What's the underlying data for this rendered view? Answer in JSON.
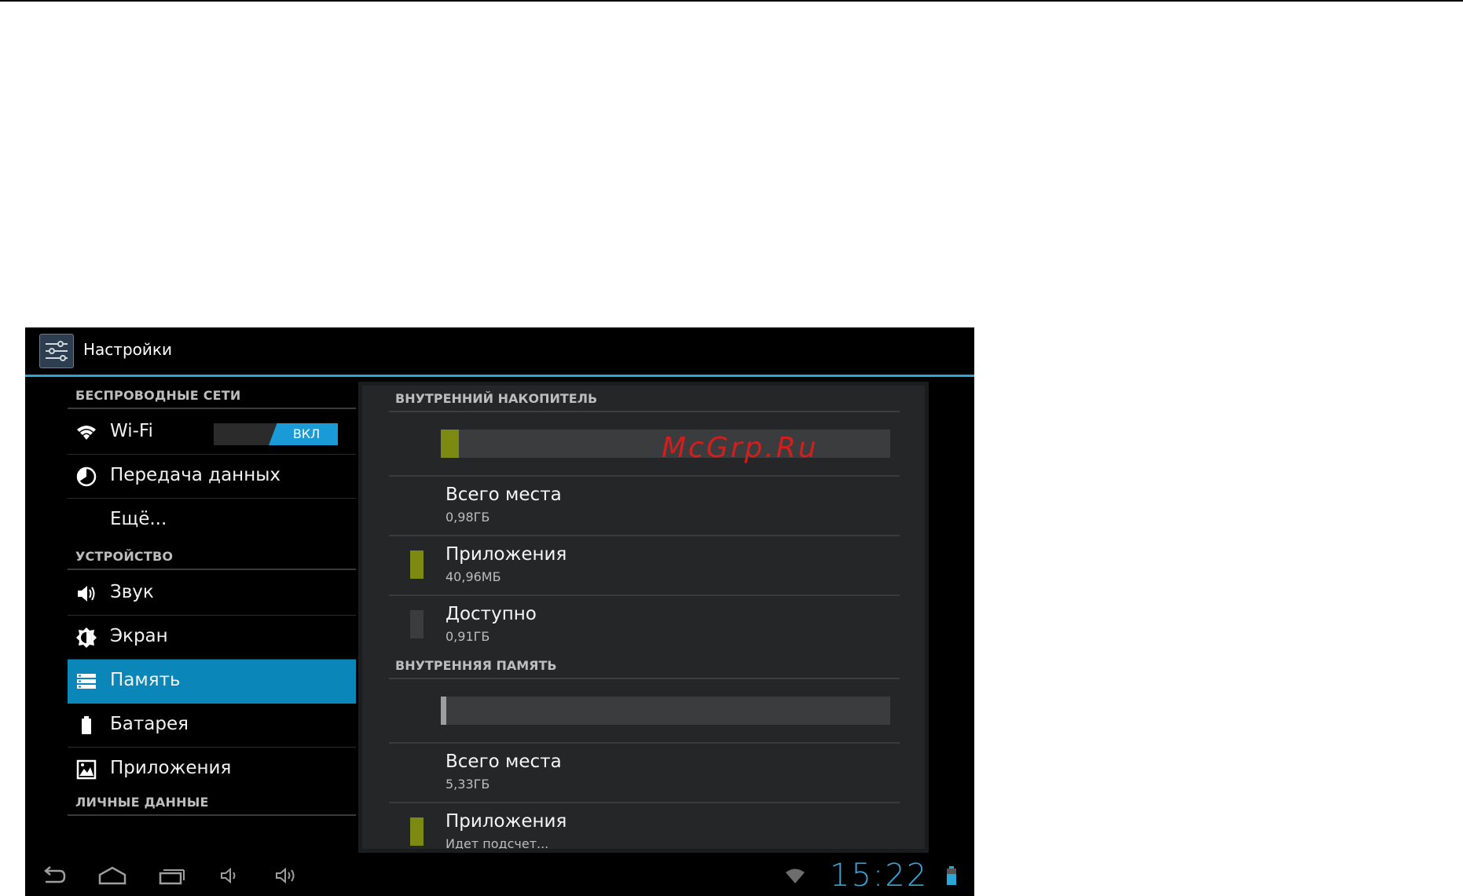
{
  "app": {
    "title": "Настройки"
  },
  "sidebar": {
    "categories": {
      "wireless": "БЕСПРОВОДНЫЕ СЕТИ",
      "device": "УСТРОЙСТВО",
      "personal": "ЛИЧНЫЕ ДАННЫЕ"
    },
    "items": [
      {
        "label": "Wi-Fi",
        "icon": "wifi-icon",
        "toggle": "ВКЛ"
      },
      {
        "label": "Передача данных",
        "icon": "data-usage-icon"
      },
      {
        "label": "Ещё..."
      },
      {
        "label": "Звук",
        "icon": "speaker-icon"
      },
      {
        "label": "Экран",
        "icon": "brightness-icon"
      },
      {
        "label": "Память",
        "icon": "storage-icon",
        "selected": true
      },
      {
        "label": "Батарея",
        "icon": "battery-icon"
      },
      {
        "label": "Приложения",
        "icon": "apps-icon"
      }
    ]
  },
  "storage": {
    "internal_storage": {
      "header": "ВНУТРЕННИЙ НАКОПИТЕЛЬ",
      "used_fraction": 0.04,
      "rows": [
        {
          "title": "Всего места",
          "value": "0,98ГБ"
        },
        {
          "title": "Приложения",
          "value": "40,96МБ",
          "color": "#7d8a12"
        },
        {
          "title": "Доступно",
          "value": "0,91ГБ",
          "color": "#3b3c3e"
        }
      ]
    },
    "internal_memory": {
      "header": "ВНУТРЕННЯЯ ПАМЯТЬ",
      "used_fraction": 0.012,
      "rows": [
        {
          "title": "Всего места",
          "value": "5,33ГБ"
        },
        {
          "title": "Приложения",
          "value": "Идет подсчет...",
          "color": "#7d8a12"
        }
      ]
    }
  },
  "colors": {
    "accent": "#2aa7d6",
    "selected": "#0a86b8",
    "apps_usage": "#7d8a12",
    "memory_usage": "#9e9e9e"
  },
  "status_bar": {
    "time": "15:22"
  },
  "watermark": "McGrp.Ru"
}
